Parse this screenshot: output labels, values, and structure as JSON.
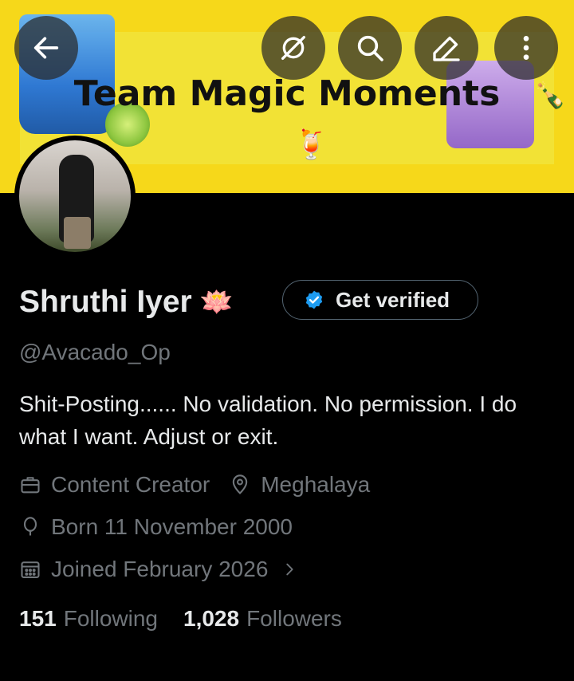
{
  "banner": {
    "title": "Team Magic Moments"
  },
  "header_actions": {
    "back": "back-arrow-icon",
    "grok": "grok-icon",
    "search": "search-icon",
    "edit": "edit-icon",
    "more": "more-vertical-icon"
  },
  "profile": {
    "name": "Shruthi Iyer",
    "name_emoji": "🪷",
    "handle": "@Avacado_Op",
    "bio": "Shit-Posting...... No validation. No permission. I do what I want. Adjust or exit.",
    "category": "Content Creator",
    "location": "Meghalaya",
    "birthday": "Born 11 November 2000",
    "joined": "Joined February 2026",
    "following_count": "151",
    "following_label": "Following",
    "followers_count": "1,028",
    "followers_label": "Followers"
  },
  "verify": {
    "label": "Get verified",
    "badge_color": "#1d9bf0"
  },
  "colors": {
    "background": "#000000",
    "banner": "#f6d81a",
    "text_primary": "#e7e9ea",
    "text_secondary": "#71767b"
  }
}
